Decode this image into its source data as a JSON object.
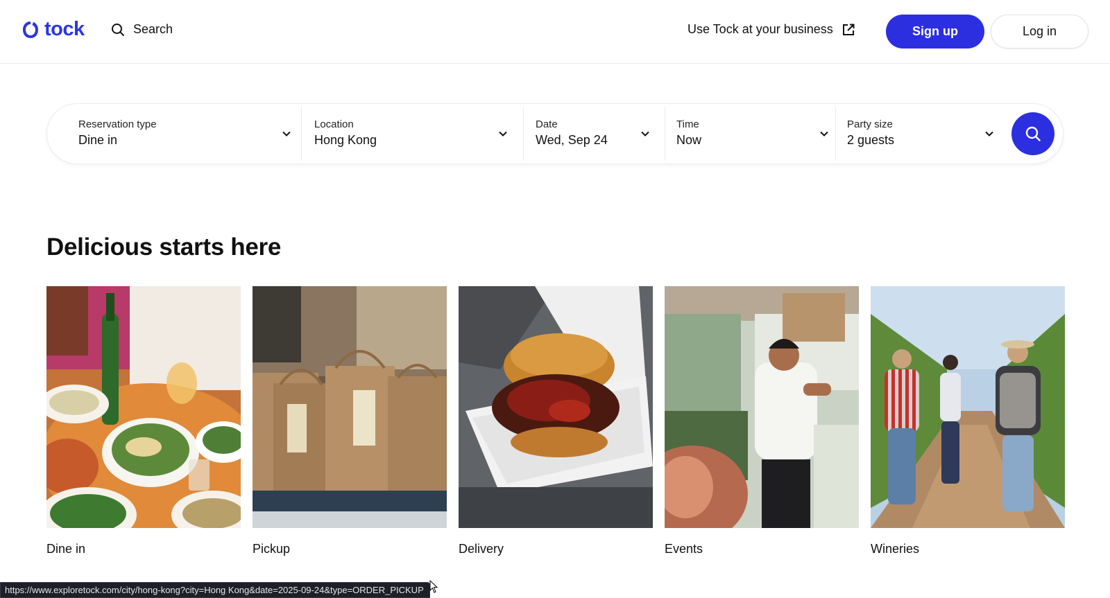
{
  "header": {
    "logo_text": "tock",
    "search_label": "Search",
    "business_link": "Use Tock at your business",
    "signup_label": "Sign up",
    "login_label": "Log in"
  },
  "search_bar": {
    "reservation_type": {
      "label": "Reservation type",
      "value": "Dine in"
    },
    "location": {
      "label": "Location",
      "value": "Hong Kong"
    },
    "date": {
      "label": "Date",
      "value": "Wed, Sep 24"
    },
    "time": {
      "label": "Time",
      "value": "Now"
    },
    "party_size": {
      "label": "Party size",
      "value": "2 guests"
    }
  },
  "section": {
    "title": "Delicious starts here",
    "categories": [
      {
        "label": "Dine in",
        "image": "dining-table-photo"
      },
      {
        "label": "Pickup",
        "image": "pickup-bags-photo"
      },
      {
        "label": "Delivery",
        "image": "burger-container-photo"
      },
      {
        "label": "Events",
        "image": "chef-event-photo"
      },
      {
        "label": "Wineries",
        "image": "vineyard-walk-photo"
      }
    ]
  },
  "status_url": "https://www.exploretock.com/city/hong-kong?city=Hong Kong&date=2025-09-24&type=ORDER_PICKUP",
  "colors": {
    "brand": "#2b2fe0",
    "text": "#111111",
    "border": "#ececec"
  }
}
